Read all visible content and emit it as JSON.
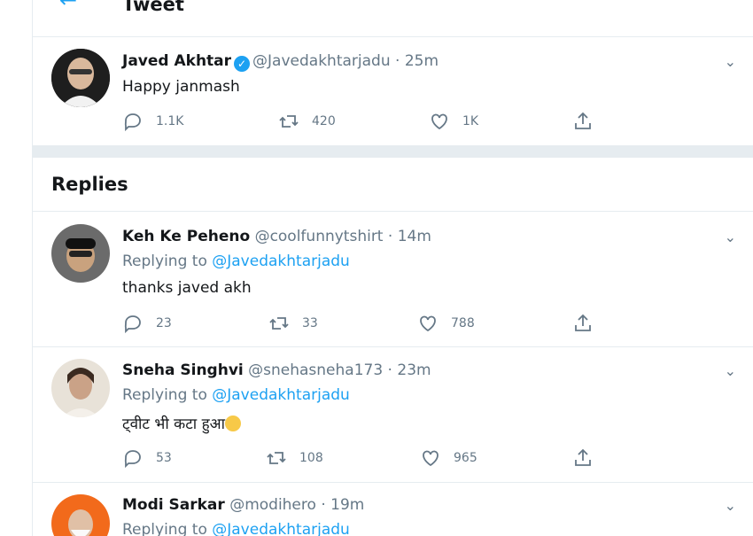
{
  "header": {
    "back_icon": "arrow-left-icon",
    "title": "Tweet"
  },
  "main_tweet": {
    "name": "Javed Akhtar",
    "handle": "@Javedakhtarjadu",
    "time": "25m",
    "text": "Happy janmash",
    "reply_count": "1.1K",
    "retweet_count": "420",
    "like_count": "1K"
  },
  "replies_title": "Replies",
  "replies": [
    {
      "name": "Keh Ke Peheno",
      "handle": "@coolfunnytshirt",
      "time": "14m",
      "replying_label": "Replying to",
      "replying_to": "@Javedakhtarjadu",
      "text": "thanks javed akh",
      "reply_count": "23",
      "retweet_count": "33",
      "like_count": "788"
    },
    {
      "name": "Sneha Singhvi",
      "handle": "@snehasneha173",
      "time": "23m",
      "replying_label": "Replying to",
      "replying_to": "@Javedakhtarjadu",
      "text": "ट्वीट भी कटा हुआ",
      "reply_count": "53",
      "retweet_count": "108",
      "like_count": "965"
    },
    {
      "name": "Modi Sarkar",
      "handle": "@modihero",
      "time": "19m",
      "replying_label": "Replying to",
      "replying_to": "@Javedakhtarjadu"
    }
  ],
  "colors": {
    "accent": "#1da1f2",
    "muted": "#657786",
    "border": "#e6ecf0"
  }
}
